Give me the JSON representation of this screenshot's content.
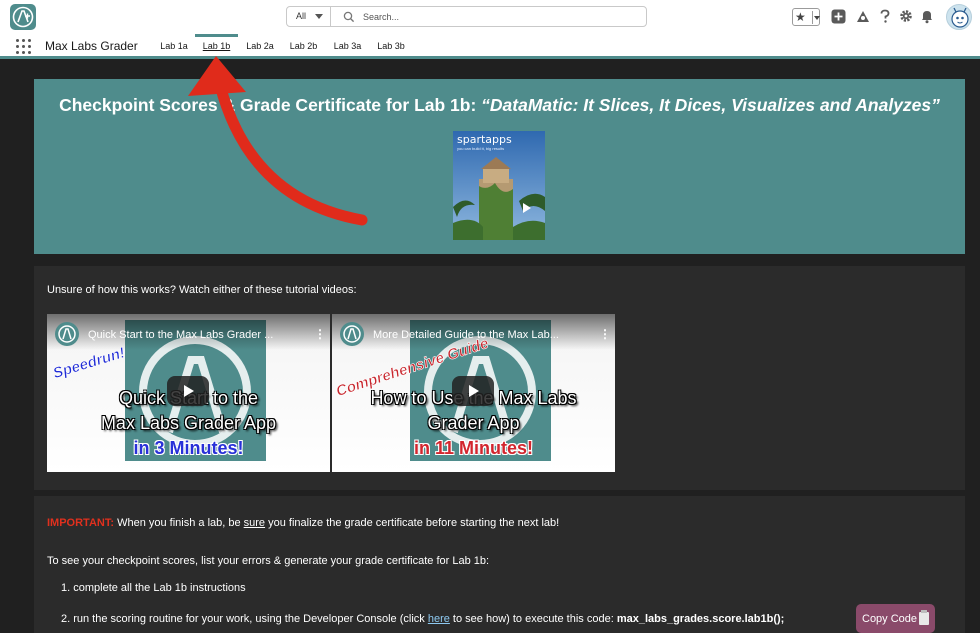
{
  "header": {
    "search_scope": "All",
    "search_placeholder": "Search..."
  },
  "nav": {
    "app_name": "Max Labs Grader",
    "tabs": [
      {
        "label": "Lab 1a"
      },
      {
        "label": "Lab 1b",
        "active": true
      },
      {
        "label": "Lab 2a"
      },
      {
        "label": "Lab 2b"
      },
      {
        "label": "Lab 3a"
      },
      {
        "label": "Lab 3b"
      }
    ]
  },
  "banner": {
    "title_main": "Checkpoint Scores & Grade Certificate for Lab 1b: ",
    "title_italic": "“DataMatic: It Slices, It Dices, Visualizes and Analyzes”",
    "image_brand": "spartapps",
    "image_brand_sub": "you can build it, big results"
  },
  "tutorials": {
    "intro": "Unsure of how this works? Watch either of these tutorial videos:",
    "videos": [
      {
        "title": "Quick Start to the Max Labs Grader ...",
        "stamp": "Speedrun!",
        "line1": "Quick Start to the",
        "line2": "Max Labs Grader App",
        "line3": "in 3 Minutes!"
      },
      {
        "title": "More Detailed Guide to the Max Lab...",
        "stamp": "Comprehensive Guide",
        "line1": "How to Use the Max Labs",
        "line2": "Grader App",
        "line3": "in 11 Minutes!"
      }
    ]
  },
  "instructions": {
    "important_label": "IMPORTANT:",
    "important_pre": " When you finish a lab, be ",
    "important_emph": "sure",
    "important_post": " you finalize the grade certificate before starting the next lab!",
    "intro": "To see your checkpoint scores, list your errors & generate your grade certificate for Lab 1b:",
    "step1": "1. complete all the Lab 1b instructions",
    "step2_pre": "2. run the scoring routine for your work, using the Developer Console (click ",
    "step2_link": "here",
    "step2_mid": " to see how) to execute this code: ",
    "step2_code": "max_labs_grades.score.lab1b();",
    "copy_button": "Copy Code"
  },
  "colors": {
    "accent": "#4f8c8c",
    "important": "#e0301e",
    "copy_button": "#8a4a6a",
    "arrow": "#e02b1b"
  }
}
